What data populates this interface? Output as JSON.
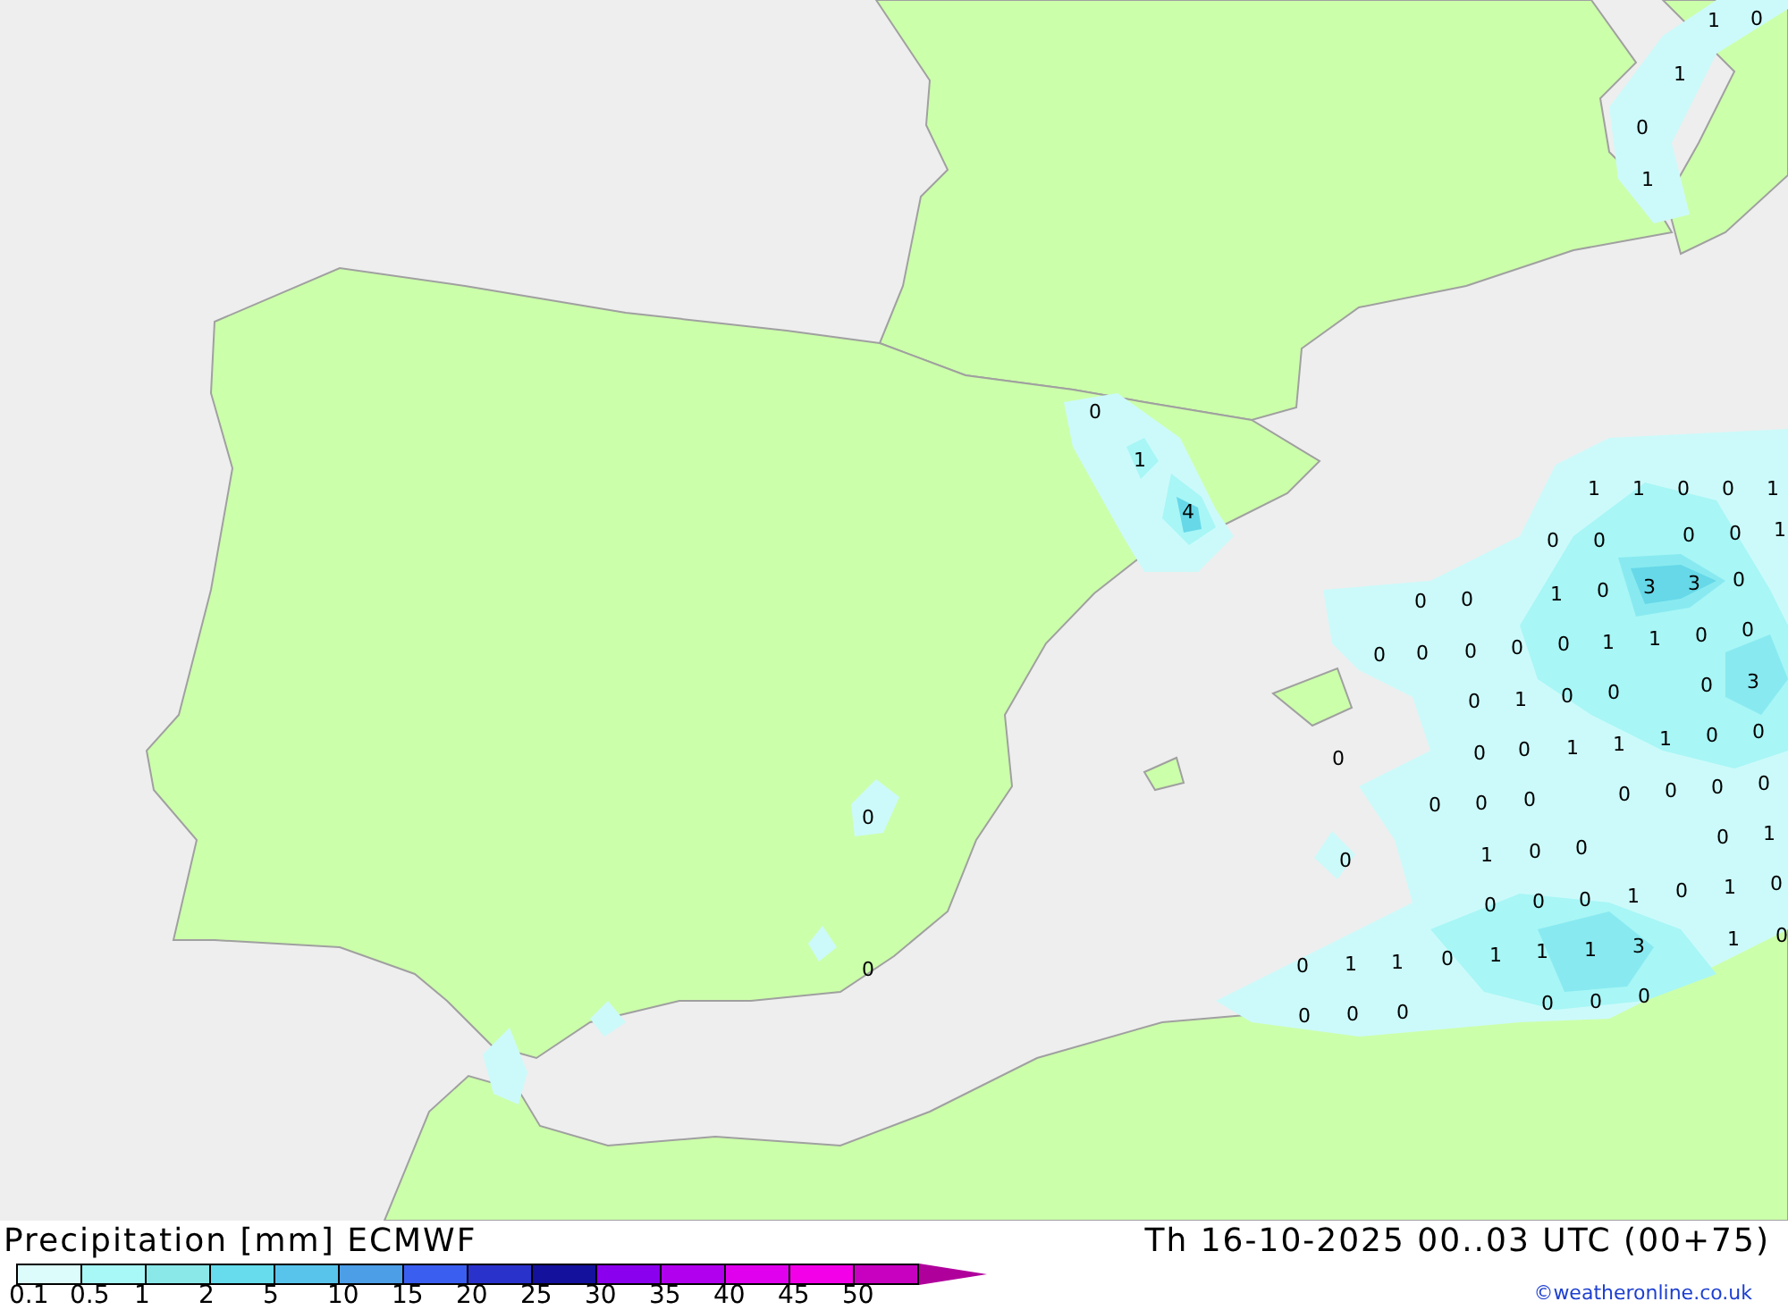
{
  "map": {
    "labels": [
      "1",
      "0",
      "1",
      "0",
      "1",
      "0",
      "1",
      "4",
      "1",
      "1",
      "0",
      "0",
      "1",
      "0",
      "0",
      "0",
      "0",
      "1",
      "1",
      "0",
      "3",
      "3",
      "0",
      "0",
      "0",
      "0",
      "0",
      "0",
      "0",
      "0",
      "1",
      "1",
      "0",
      "0",
      "0",
      "1",
      "0",
      "0",
      "0",
      "3",
      "0",
      "0",
      "0",
      "1",
      "1",
      "1",
      "0",
      "0",
      "0",
      "0",
      "0",
      "0",
      "0",
      "0",
      "0",
      "0",
      "1",
      "0",
      "0",
      "0",
      "1",
      "0",
      "0",
      "0",
      "1",
      "0",
      "1",
      "0",
      "0",
      "1",
      "1",
      "0",
      "1",
      "1",
      "1",
      "3",
      "1",
      "0",
      "0",
      "0",
      "0",
      "0",
      "0",
      "0",
      "0",
      "0"
    ]
  },
  "footer": {
    "title": "Precipitation [mm] ECMWF",
    "valid_time": "Th 16-10-2025 00..03 UTC (00+75)",
    "credit": "©weatheronline.co.uk",
    "legend": {
      "swatches": [
        {
          "color": "#dcfcfc"
        },
        {
          "color": "#a8f8f8"
        },
        {
          "color": "#8ae8e8"
        },
        {
          "color": "#66dcec"
        },
        {
          "color": "#58c4ec"
        },
        {
          "color": "#4c9ee6"
        },
        {
          "color": "#3a5ef0"
        },
        {
          "color": "#2a32cc"
        },
        {
          "color": "#14119c"
        },
        {
          "color": "#8a00ee"
        },
        {
          "color": "#b000ee"
        },
        {
          "color": "#e000ee"
        },
        {
          "color": "#f400e8"
        },
        {
          "color": "#c800c0"
        }
      ],
      "ticks": [
        "0.1",
        "0.5",
        "1",
        "2",
        "5",
        "10",
        "15",
        "20",
        "25",
        "30",
        "35",
        "40",
        "45",
        "50"
      ]
    }
  }
}
